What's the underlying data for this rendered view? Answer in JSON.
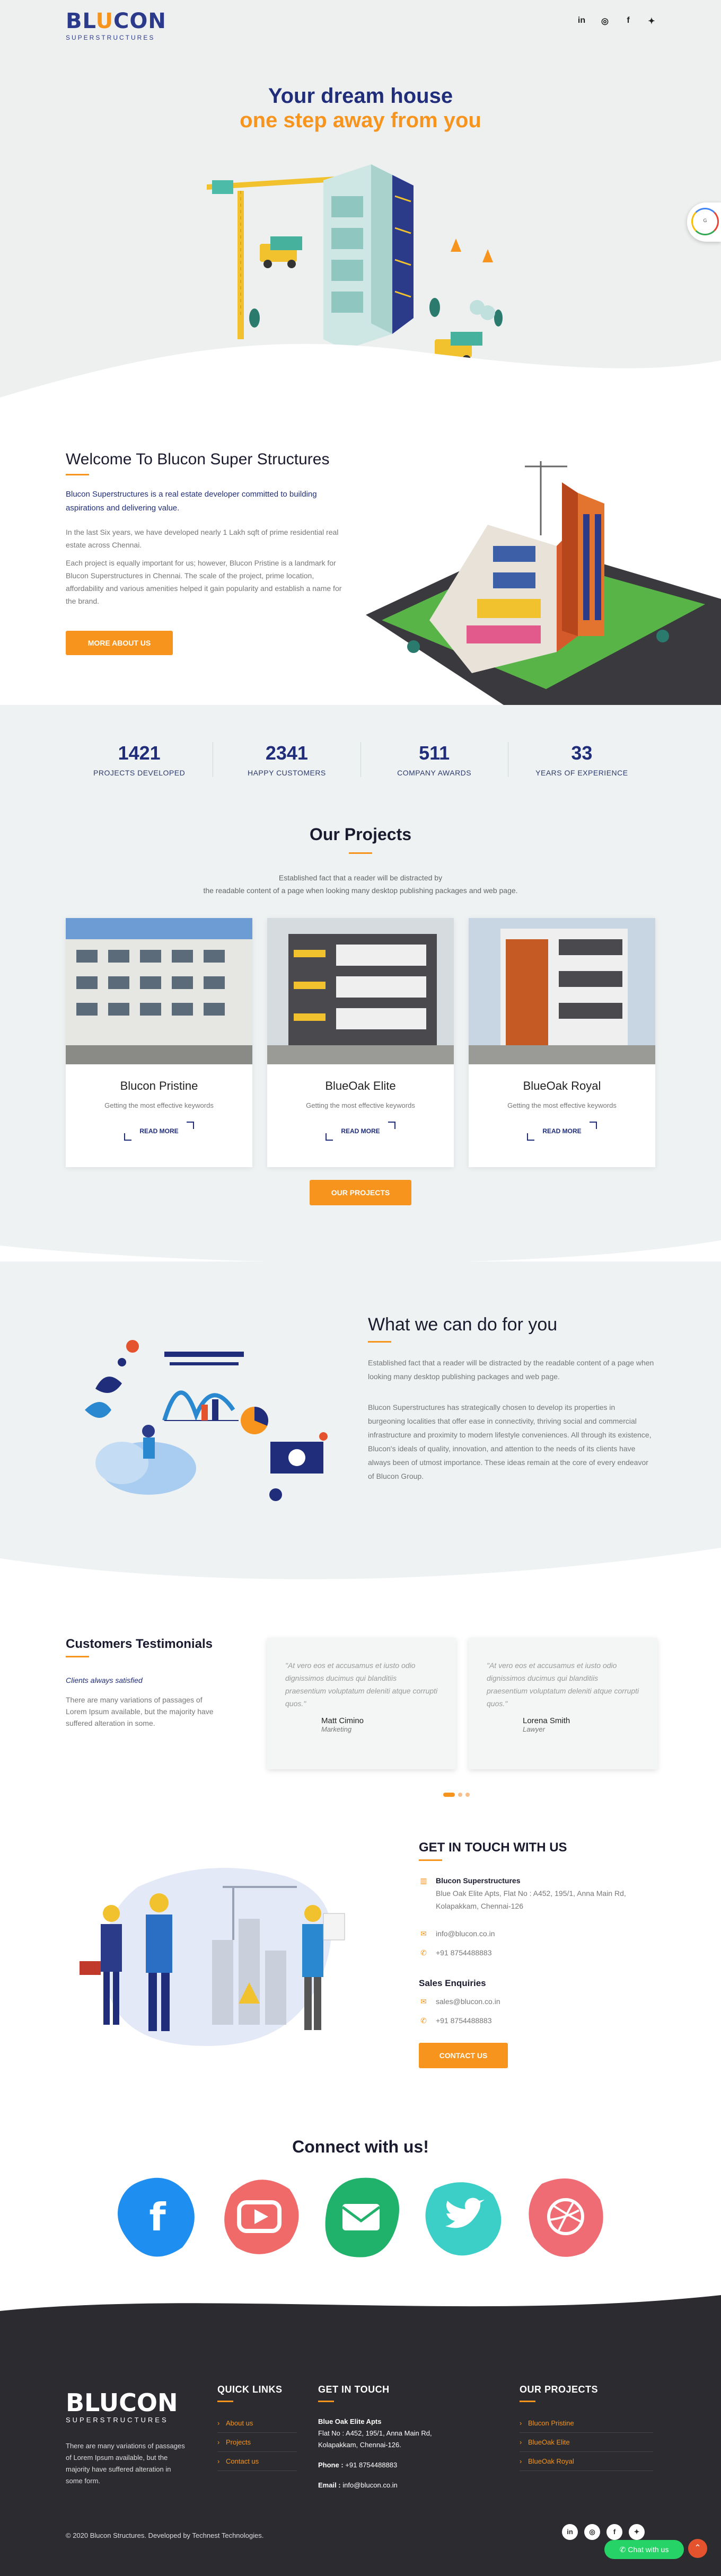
{
  "brand": {
    "logo_text_left": "BL",
    "logo_text_hl": "U",
    "logo_text_right": "CON",
    "logo_sub": "SUPERSTRUCTURES",
    "accent": "#f7941d",
    "primary": "#1f2d7a"
  },
  "header_social": [
    {
      "icon": "linkedin-icon",
      "glyph": "in"
    },
    {
      "icon": "instagram-icon",
      "glyph": "◎"
    },
    {
      "icon": "facebook-icon",
      "glyph": "f"
    },
    {
      "icon": "twitter-icon",
      "glyph": "✦"
    }
  ],
  "hero": {
    "title_line1": "Your dream house",
    "title_line2": "one step away from you"
  },
  "welcome": {
    "title": "Welcome To Blucon Super Structures",
    "lead": "Blucon Superstructures is a real estate developer committed to building aspirations and delivering value.",
    "p1": "In the last Six years, we have developed nearly 1 Lakh sqft of prime residential real estate across Chennai.",
    "p2": "Each project is equally important for us; however, Blucon Pristine is a landmark for Blucon Superstructures in Chennai. The scale of the project, prime location, affordability and various amenities helped it gain popularity and establish a name for the brand.",
    "button": "MORE ABOUT US"
  },
  "stats": [
    {
      "value": "1421",
      "label": "PROJECTS DEVELOPED"
    },
    {
      "value": "2341",
      "label": "HAPPY CUSTOMERS"
    },
    {
      "value": "511",
      "label": "COMPANY AWARDS"
    },
    {
      "value": "33",
      "label": "YEARS OF EXPERIENCE"
    }
  ],
  "projects": {
    "title": "Our Projects",
    "desc_line1": "Established fact that a reader will be distracted by",
    "desc_line2": "the readable content of a page when looking many desktop publishing packages and web page.",
    "items": [
      {
        "name": "Blucon Pristine",
        "desc": "Getting the most effective keywords",
        "more": "READ MORE"
      },
      {
        "name": "BlueOak Elite",
        "desc": "Getting the most effective keywords",
        "more": "READ MORE"
      },
      {
        "name": "BlueOak Royal",
        "desc": "Getting the most effective keywords",
        "more": "READ MORE"
      }
    ],
    "button": "OUR PROJECTS"
  },
  "what": {
    "title": "What we can do for you",
    "p1": "Established fact that a reader will be distracted by the readable content of a page when looking many desktop publishing packages and web page.",
    "p2": "Blucon Superstructures has strategically chosen to develop its properties in burgeoning localities that offer ease in connectivity, thriving social and commercial infrastructure and proximity to modern lifestyle conveniences. All through its existence, Blucon's ideals of quality, innovation, and attention to the needs of its clients have always been of utmost importance. These ideas remain at the core of every endeavor of Blucon Group."
  },
  "testimonials": {
    "title": "Customers Testimonials",
    "tag": "Clients always satisfied",
    "text": "There are many variations of passages of Lorem Ipsum available, but the majority have suffered alteration in some.",
    "items": [
      {
        "quote": "\"At vero eos et accusamus et iusto odio dignissimos ducimus qui blanditiis praesentium voluptatum deleniti atque corrupti quos.\"",
        "name": "Matt Cimino",
        "role": "Marketing"
      },
      {
        "quote": "\"At vero eos et accusamus et iusto odio dignissimos ducimus qui blanditiis praesentium voluptatum deleniti atque corrupti quos.\"",
        "name": "Lorena Smith",
        "role": "Lawyer"
      }
    ]
  },
  "contact": {
    "title": "GET IN TOUCH WITH US",
    "company": "Blucon Superstructures",
    "address": "Blue Oak Elite Apts, Flat No : A452, 195/1, Anna Main Rd, Kolapakkam, Chennai-126",
    "email": "info@blucon.co.in",
    "phone": "+91 8754488883",
    "sales_title": "Sales Enquiries",
    "sales_email": "sales@blucon.co.in",
    "sales_phone": "+91 8754488883",
    "button": "CONTACT US"
  },
  "connect": {
    "title": "Connect with us!",
    "items": [
      {
        "icon": "facebook-icon",
        "glyph": "f",
        "color": "#1e8ff0"
      },
      {
        "icon": "youtube-icon",
        "glyph": "▶",
        "color": "#f05a5a"
      },
      {
        "icon": "email-icon",
        "glyph": "✉",
        "color": "#20b26b"
      },
      {
        "icon": "twitter-icon",
        "glyph": "🐦",
        "color": "#3ccfc8"
      },
      {
        "icon": "dribbble-icon",
        "glyph": "◍",
        "color": "#f06c74"
      }
    ]
  },
  "footer": {
    "text": "There are many variations of passages of Lorem Ipsum available, but the majority have suffered alteration in some form.",
    "quick_title": "QUICK LINKS",
    "quick_links": [
      "About us",
      "Projects",
      "Contact us"
    ],
    "touch_title": "GET IN TOUCH",
    "touch_name": "Blue Oak Elite Apts",
    "touch_address": "Flat No : A452, 195/1, Anna Main Rd, Kolapakkam, Chennai-126.",
    "phone_label": "Phone :",
    "phone": "+91 8754488883",
    "email_label": "Email :",
    "email": "info@blucon.co.in",
    "projects_title": "OUR PROJECTS",
    "project_links": [
      "Blucon Pristine",
      "BlueOak Elite",
      "BlueOak Royal"
    ],
    "copyright": "© 2020 Blucon Structures. Developed by Technest Technologies.",
    "chat": "Chat with us"
  }
}
